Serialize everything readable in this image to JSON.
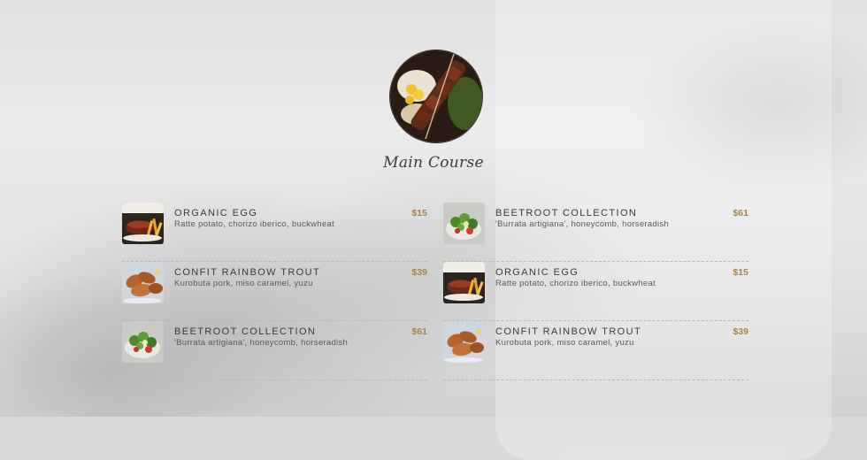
{
  "section": {
    "title": "Main Course"
  },
  "menu": {
    "left": [
      {
        "name": "ORGANIC EGG",
        "desc": "Ratte potato, chorizo iberico, buckwheat",
        "price": "$15",
        "image": "steak-fries"
      },
      {
        "name": "CONFIT RAINBOW TROUT",
        "desc": "Kurobuta pork, miso caramel, yuzu",
        "price": "$39",
        "image": "chicken-wings"
      },
      {
        "name": "BEETROOT COLLECTION",
        "desc": "'Burrata artigiana', honeycomb, horseradish",
        "price": "$61",
        "image": "salad"
      }
    ],
    "right": [
      {
        "name": "BEETROOT COLLECTION",
        "desc": "'Burrata artigiana', honeycomb, horseradish",
        "price": "$61",
        "image": "salad"
      },
      {
        "name": "ORGANIC EGG",
        "desc": "Ratte potato, chorizo iberico, buckwheat",
        "price": "$15",
        "image": "steak-fries"
      },
      {
        "name": "CONFIT RAINBOW TROUT",
        "desc": "Kurobuta pork, miso caramel, yuzu",
        "price": "$39",
        "image": "chicken-wings"
      }
    ]
  },
  "colors": {
    "price": "#a9824d",
    "text": "#3a3a3a",
    "divider": "#b9b9b9"
  }
}
